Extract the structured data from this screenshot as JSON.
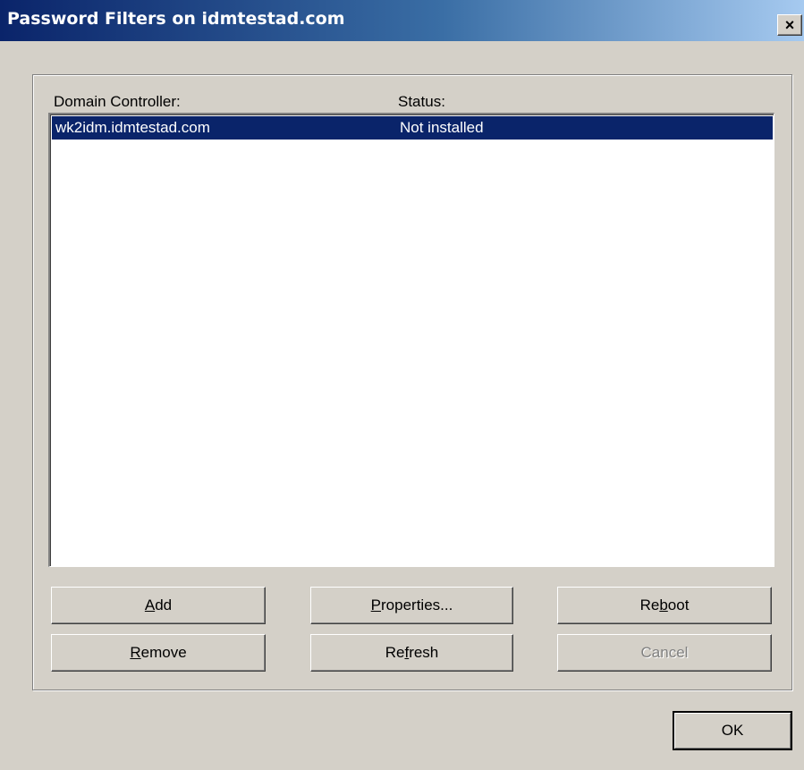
{
  "window": {
    "title": "Password Filters on idmtestad.com",
    "close_glyph": "×",
    "close_icon": "close-icon"
  },
  "list": {
    "columns": [
      "Domain Controller:",
      "Status:"
    ],
    "rows": [
      {
        "controller": "wk2idm.idmtestad.com",
        "status": "Not installed",
        "selected": true
      }
    ]
  },
  "buttons": {
    "add": {
      "pre": "",
      "acc": "A",
      "post": "dd"
    },
    "properties": {
      "pre": "",
      "acc": "P",
      "post": "roperties..."
    },
    "reboot": {
      "pre": "Re",
      "acc": "b",
      "post": "oot"
    },
    "remove": {
      "pre": "",
      "acc": "R",
      "post": "emove"
    },
    "refresh": {
      "pre": "Re",
      "acc": "f",
      "post": "resh"
    },
    "cancel": {
      "label": "Cancel",
      "disabled": true
    },
    "ok": {
      "label": "OK"
    }
  },
  "colors": {
    "selection": "#0a246a",
    "face": "#d4d0c8"
  }
}
